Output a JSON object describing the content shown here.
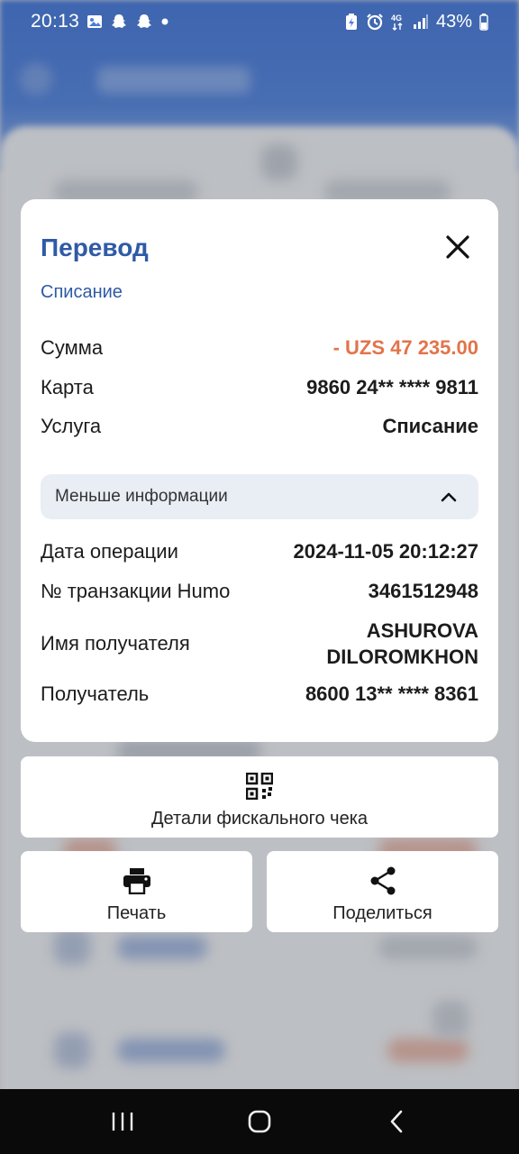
{
  "status_bar": {
    "time": "20:13",
    "battery": "43%",
    "network": "4G"
  },
  "modal": {
    "title": "Перевод",
    "subtitle": "Списание",
    "rows": [
      {
        "label": "Сумма",
        "value": "- UZS 47 235.00"
      },
      {
        "label": "Карта",
        "value": "9860 24** **** 9811"
      },
      {
        "label": "Услуга",
        "value": "Списание"
      }
    ],
    "toggle_label": "Меньше информации",
    "details": [
      {
        "label": "Дата операции",
        "value": "2024-11-05 20:12:27"
      },
      {
        "label": "№ транзакции Humo",
        "value": "3461512948"
      },
      {
        "label": "Имя получателя",
        "value_line1": "ASHUROVA",
        "value_line2": "DILOROMKHON"
      },
      {
        "label": "Получатель",
        "value": "8600 13** **** 8361"
      }
    ]
  },
  "actions": {
    "fiscal_label": "Детали фискального чека",
    "print_label": "Печать",
    "share_label": "Поделиться"
  },
  "colors": {
    "accent": "#2f5aa6",
    "debit": "#e2744a",
    "header_blue": "#4a7ddb"
  },
  "icons": [
    "photo-icon",
    "snapchat-icon",
    "snapchat-icon",
    "dot-icon",
    "battery-saver-icon",
    "alarm-icon",
    "4g-icon",
    "signal-icon",
    "battery-icon",
    "close-icon",
    "chevron-up-icon",
    "qr-code-icon",
    "printer-icon",
    "share-icon",
    "recents-icon",
    "home-icon",
    "back-icon"
  ]
}
